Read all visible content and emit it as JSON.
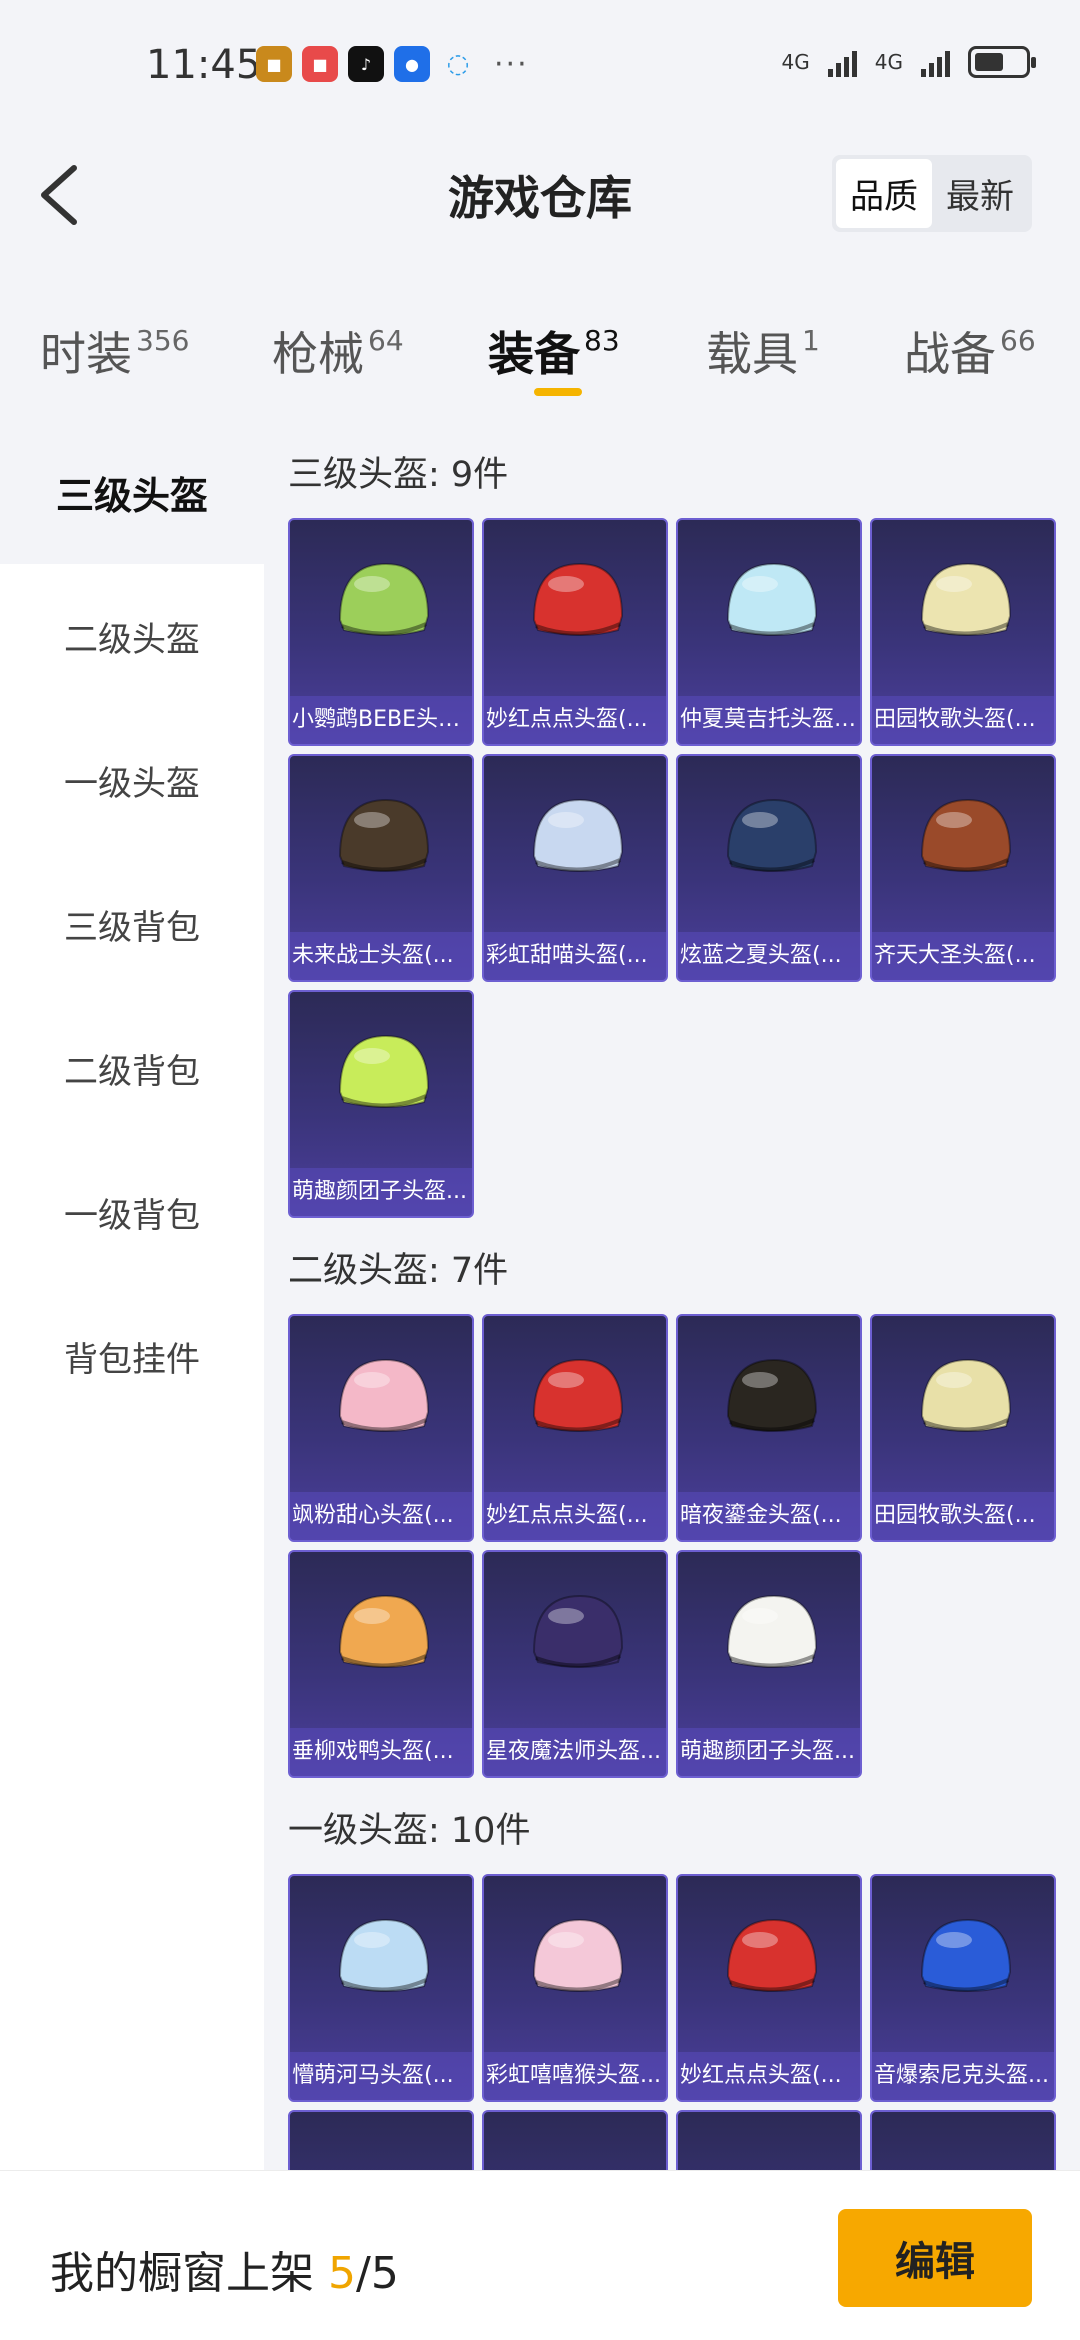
{
  "status": {
    "time": "11:45",
    "network1": "4G",
    "network2": "4G"
  },
  "header": {
    "title": "游戏仓库",
    "sort_quality": "品质",
    "sort_newest": "最新"
  },
  "tabs": [
    {
      "label": "时装",
      "count": "356"
    },
    {
      "label": "枪械",
      "count": "64"
    },
    {
      "label": "装备",
      "count": "83"
    },
    {
      "label": "载具",
      "count": "1"
    },
    {
      "label": "战备",
      "count": "66"
    }
  ],
  "sidebar": {
    "items": [
      {
        "label": "三级头盔"
      },
      {
        "label": "二级头盔"
      },
      {
        "label": "一级头盔"
      },
      {
        "label": "三级背包"
      },
      {
        "label": "二级背包"
      },
      {
        "label": "一级背包"
      },
      {
        "label": "背包挂件"
      }
    ]
  },
  "sections": [
    {
      "title": "三级头盔: 9件",
      "items": [
        {
          "name": "小鹦鹉BEBE头盔(...",
          "color": "#9ccf5a"
        },
        {
          "name": "妙红点点头盔(...",
          "color": "#d8322e"
        },
        {
          "name": "仲夏莫吉托头盔(...",
          "color": "#bfe8f5"
        },
        {
          "name": "田园牧歌头盔(...",
          "color": "#ece4b0"
        },
        {
          "name": "未来战士头盔(...",
          "color": "#4a3a2a"
        },
        {
          "name": "彩虹甜喵头盔(...",
          "color": "#c8d8f0"
        },
        {
          "name": "炫蓝之夏头盔(...",
          "color": "#2a3f6a"
        },
        {
          "name": "齐天大圣头盔(...",
          "color": "#9a4a2a"
        },
        {
          "name": "萌趣颜团子头盔...",
          "color": "#c8ec5a"
        }
      ]
    },
    {
      "title": "二级头盔: 7件",
      "items": [
        {
          "name": "飒粉甜心头盔(...",
          "color": "#f4b8c8"
        },
        {
          "name": "妙红点点头盔(...",
          "color": "#d8322e"
        },
        {
          "name": "暗夜鎏金头盔(...",
          "color": "#2a2620"
        },
        {
          "name": "田园牧歌头盔(...",
          "color": "#e8e0a8"
        },
        {
          "name": "垂柳戏鸭头盔(...",
          "color": "#f0a850"
        },
        {
          "name": "星夜魔法师头盔...",
          "color": "#3a2e6a"
        },
        {
          "name": "萌趣颜团子头盔...",
          "color": "#f4f4f0"
        }
      ]
    },
    {
      "title": "一级头盔: 10件",
      "items": [
        {
          "name": "懵萌河马头盔(...",
          "color": "#bcdcf4"
        },
        {
          "name": "彩虹嘻嘻猴头盔...",
          "color": "#f4c8d8"
        },
        {
          "name": "妙红点点头盔(...",
          "color": "#d8322e"
        },
        {
          "name": "音爆索尼克头盔...",
          "color": "#2a5cd8"
        }
      ]
    }
  ],
  "bottom": {
    "label": "我的橱窗上架",
    "count": "5",
    "sep": "/",
    "total": "5",
    "edit_label": "编辑"
  },
  "colors": {
    "accent": "#f7a800",
    "card_bg": "#3a347a"
  }
}
